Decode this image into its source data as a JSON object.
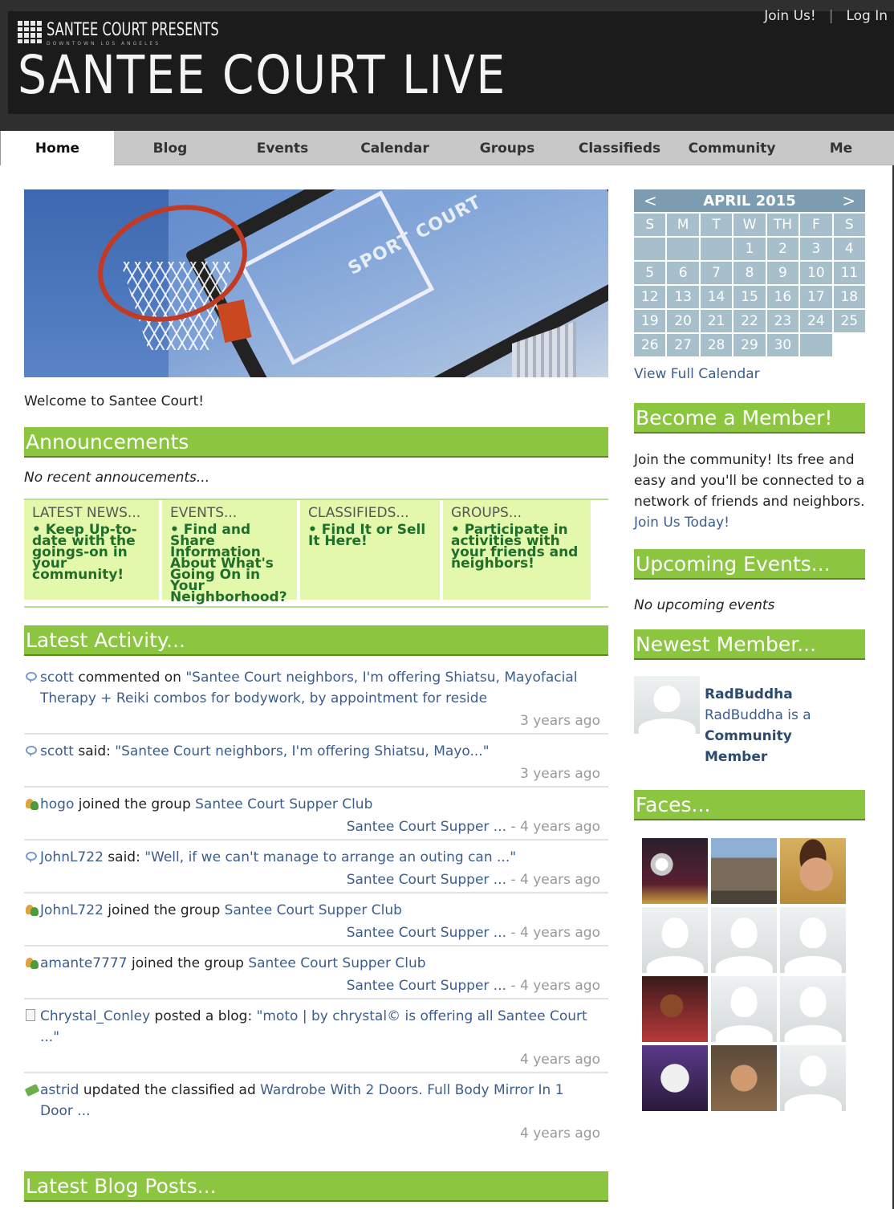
{
  "header": {
    "presents": "SANTEE COURT PRESENTS",
    "presents_sub": "DOWNTOWN LOS ANGELES",
    "title": "SANTEE COURT LIVE",
    "join_label": "Join Us!",
    "separator": "|",
    "login_label": "Log In"
  },
  "nav": {
    "tabs": [
      "Home",
      "Blog",
      "Events",
      "Calendar",
      "Groups",
      "Classifieds",
      "Community",
      "Me"
    ],
    "active": "Home"
  },
  "main": {
    "hero_logo": "SPORT COURT",
    "welcome": "Welcome to Santee Court!",
    "announcements_title": "Announcements",
    "no_announcements": "No recent annoucements...",
    "promo": [
      {
        "title": "LATEST NEWS...",
        "link": "Keep Up-to-date with the goings-on in your community!"
      },
      {
        "title": "EVENTS...",
        "link": "Find and Share Information About What's Going On in Your Neighborhood?"
      },
      {
        "title": "CLASSIFIEDS...",
        "link": "Find It or Sell It Here!"
      },
      {
        "title": "GROUPS...",
        "link": "Participate in activities with your friends and neighbors!"
      }
    ],
    "activity_title": "Latest Activity...",
    "activity": [
      {
        "user": "scott",
        "action": " commented on ",
        "link": "\"Santee Court neighbors, I'm offering Shiatsu, Mayofacial Therapy + Reiki combos for bodywork, by appointment for reside",
        "group": "",
        "sep": "",
        "time": "3 years ago"
      },
      {
        "user": "scott",
        "action": " said: ",
        "link": "\"Santee Court neighbors, I'm offering Shiatsu, Mayo...\"",
        "group": "",
        "sep": "",
        "time": "3 years ago"
      },
      {
        "user": "hogo",
        "action": " joined the group ",
        "link": "Santee Court Supper Club",
        "group": "Santee Court Supper ...",
        "sep": " - ",
        "time": "4 years ago"
      },
      {
        "user": "JohnL722",
        "action": " said: ",
        "link": "\"Well, if we can't manage to arrange an outing can ...\"",
        "group": "Santee Court Supper ...",
        "sep": " - ",
        "time": "4 years ago"
      },
      {
        "user": "JohnL722",
        "action": " joined the group ",
        "link": "Santee Court Supper Club",
        "group": "Santee Court Supper ...",
        "sep": " - ",
        "time": "4 years ago"
      },
      {
        "user": "amante7777",
        "action": " joined the group ",
        "link": "Santee Court Supper Club",
        "group": "Santee Court Supper ...",
        "sep": " - ",
        "time": "4 years ago"
      },
      {
        "user": "Chrystal_Conley",
        "action": " posted a blog: ",
        "link": "\"moto | by chrystal© is offering all Santee Court ...\"",
        "group": "",
        "sep": "",
        "time": "4 years ago"
      },
      {
        "user": "astrid",
        "action": " updated the classified ad ",
        "link": "Wardrobe With 2 Doors. Full Body Mirror In 1 Door ...",
        "group": "",
        "sep": "",
        "time": "4 years ago"
      }
    ],
    "blog_title": "Latest Blog Posts..."
  },
  "sidebar": {
    "calendar": {
      "prev": "<",
      "month": "APRIL 2015",
      "next": ">",
      "days": [
        "S",
        "M",
        "T",
        "W",
        "TH",
        "F",
        "S"
      ],
      "cells": [
        "",
        "",
        "",
        "1",
        "2",
        "3",
        "4",
        "5",
        "6",
        "7",
        "8",
        "9",
        "10",
        "11",
        "12",
        "13",
        "14",
        "15",
        "16",
        "17",
        "18",
        "19",
        "20",
        "21",
        "22",
        "23",
        "24",
        "25",
        "26",
        "27",
        "28",
        "29",
        "30",
        ""
      ],
      "view_full": "View Full Calendar"
    },
    "member_title": "Become a Member!",
    "member_text": "Join the community! Its free and easy and you'll be connected to a network of friends and neighbors. ",
    "member_link": "Join Us Today!",
    "events_title": "Upcoming Events...",
    "no_events": "No upcoming events",
    "newest_title": "Newest Member...",
    "newest_name": "RadBuddha",
    "newest_desc": "RadBuddha is a",
    "newest_role": "Community Member",
    "faces_title": "Faces...",
    "faces": [
      "photo1",
      "photo2",
      "photo3",
      "default",
      "default",
      "default",
      "photo4",
      "default",
      "default",
      "photo5",
      "photo6",
      "default"
    ]
  },
  "colors": {
    "accent_green": "#8cc53f",
    "link_blue": "#3b5e8c",
    "calendar_blue": "#a6bfca",
    "header_dark": "#1b1b1b"
  }
}
